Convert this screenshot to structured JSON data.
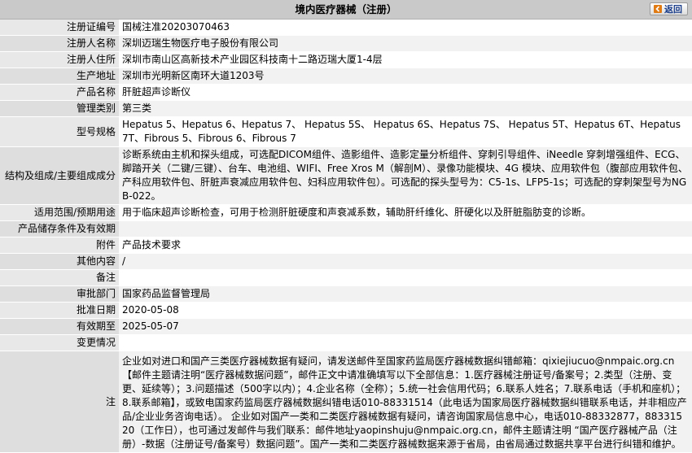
{
  "header": {
    "title": "境内医疗器械（注册）",
    "back_label": "返回"
  },
  "rows": [
    {
      "label": "注册证编号",
      "value": "国械注准20203070463"
    },
    {
      "label": "注册人名称",
      "value": "深圳迈瑞生物医疗电子股份有限公司"
    },
    {
      "label": "注册人住所",
      "value": "深圳市南山区高新技术产业园区科技南十二路迈瑞大厦1-4层"
    },
    {
      "label": "生产地址",
      "value": "深圳市光明新区南环大道1203号"
    },
    {
      "label": "产品名称",
      "value": "肝脏超声诊断仪"
    },
    {
      "label": "管理类别",
      "value": "第三类"
    },
    {
      "label": "型号规格",
      "value": "Hepatus 5、Hepatus 6、Hepatus 7、 Hepatus 5S、 Hepatus 6S、Hepatus 7S、 Hepatus 5T、Hepatus 6T、Hepatus 7T、Fibrous 5、Fibrous 6、Fibrous 7"
    },
    {
      "label": "结构及组成/主要组成成分",
      "value": "诊断系统由主机和探头组成，可选配DICOM组件、造影组件、造影定量分析组件、穿刺引导组件、iNeedle 穿刺增强组件、ECG、脚踏开关（二键/三键）、台车、电池组、WIFI、Free Xros M（解剖M）、录像功能模块、4G 模块、应用软件包（腹部应用软件包、产科应用软件包、肝脏声衰减应用软件包、妇科应用软件包）。可选配的探头型号为：C5-1s、LFP5-1s；可选配的穿刺架型号为NGB-022。"
    },
    {
      "label": "适用范围/预期用途",
      "value": "用于临床超声诊断检查，可用于检测肝脏硬度和声衰减系数，辅助肝纤维化、肝硬化以及肝脏脂肪变的诊断。"
    },
    {
      "label": "产品储存条件及有效期",
      "value": ""
    },
    {
      "label": "附件",
      "value": "产品技术要求"
    },
    {
      "label": "其他内容",
      "value": "/"
    },
    {
      "label": "备注",
      "value": ""
    },
    {
      "label": "审批部门",
      "value": "国家药品监督管理局"
    },
    {
      "label": "批准日期",
      "value": "2020-05-08"
    },
    {
      "label": "有效期至",
      "value": "2025-05-07"
    },
    {
      "label": "变更情况",
      "value": ""
    }
  ],
  "note": {
    "label": "注",
    "text": "企业如对进口和国产三类医疗器械数据有疑问，请发送邮件至国家药监局医疗器械数据纠错邮箱：qixiejiucuo@nmpaic.org.cn【邮件主题请注明“医疗器械数据问题”，邮件正文中请准确填写以下全部信息：1.医疗器械注册证号/备案号；2.类型（注册、变更、延续等）；3.问题描述（500字以内）；4.企业名称（全称）；5.统一社会信用代码；6.联系人姓名；7.联系电话（手机和座机）；8.联系邮箱】，或致电国家药监局医疗器械数据纠错电话010-88331514（此电话为国家局医疗器械数据纠错联系电话，并非相应产品/企业业务咨询电话）。 企业如对国产一类和二类医疗器械数据有疑问，请咨询国家局信息中心，电话010-88332877，88331520（工作日），也可通过发邮件与我们联系：邮件地址yaopinshuju@nmpaic.org.cn，邮件主题请注明 “国产医疗器械产品（注册）-数据（注册证号/备案号）数据问题”。国产一类和二类医疗器械数据来源于省局，由省局通过数据共享平台进行纠错和维护。"
  }
}
